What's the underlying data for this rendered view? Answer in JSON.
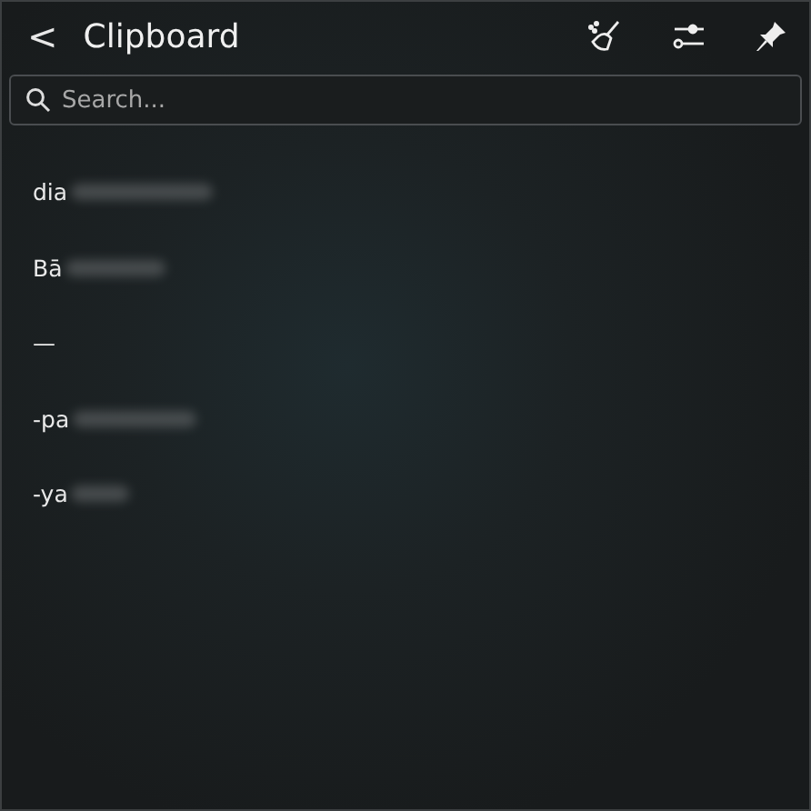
{
  "header": {
    "back": "<",
    "title": "Clipboard"
  },
  "search": {
    "placeholder": "Search..."
  },
  "items": [
    {
      "text": "dia"
    },
    {
      "text": "Bā"
    },
    {
      "text": "—"
    },
    {
      "text": "-pa"
    },
    {
      "text": "-ya"
    }
  ]
}
